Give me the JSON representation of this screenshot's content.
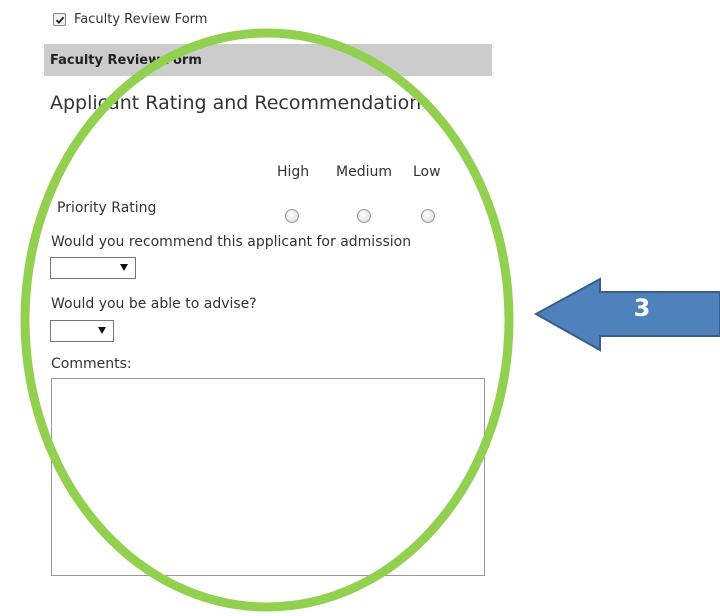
{
  "top_checkbox": {
    "label": "Faculty Review Form",
    "checked": true
  },
  "section": {
    "title": "Faculty Review Form"
  },
  "form": {
    "heading": "Applicant Rating and Recommendation",
    "rating": {
      "columns": [
        "High",
        "Medium",
        "Low"
      ],
      "row_label": "Priority Rating"
    },
    "recommend": {
      "label": "Would you recommend this applicant for admission",
      "value": ""
    },
    "advise": {
      "label": "Would you be able to advise?",
      "value": ""
    },
    "comments": {
      "label": "Comments:",
      "value": ""
    }
  },
  "annotation": {
    "callout_number": "3",
    "ellipse_color": "#92d050",
    "arrow_color": "#4f81bd",
    "arrow_border_color": "#385d8a"
  }
}
